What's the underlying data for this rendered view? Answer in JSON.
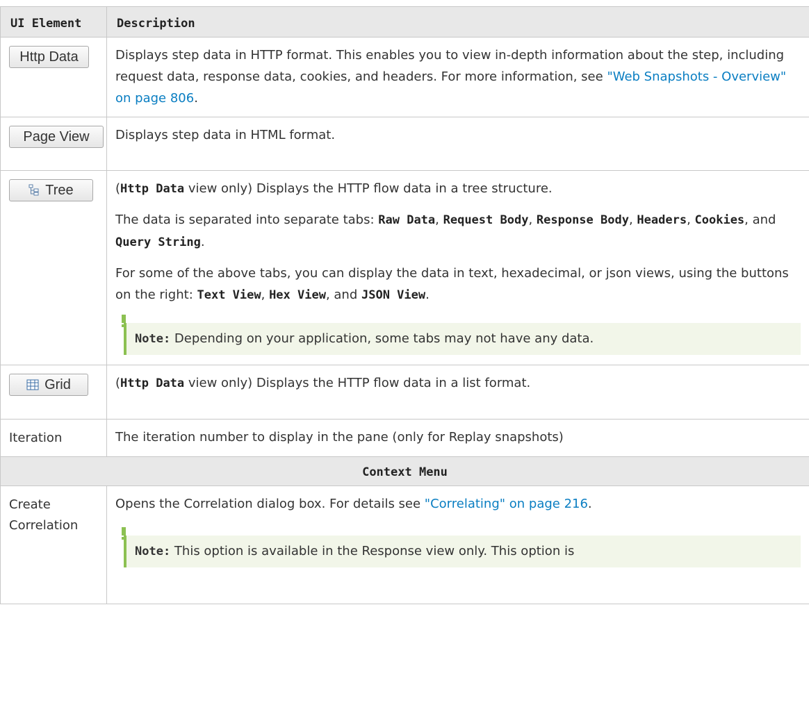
{
  "header": {
    "col1": "UI Element",
    "col2": "Description"
  },
  "rows": {
    "http_data": {
      "button_label": "Http Data",
      "desc_before_link": "Displays step data in HTTP format. This enables you to view in-depth information about the step, including request data, response data, cookies, and headers. For more information, see ",
      "link": "\"Web Snapshots - Overview\" on page 806",
      "desc_after_link": "."
    },
    "page_view": {
      "button_label": "Page View",
      "desc": "Displays step data in HTML format."
    },
    "tree": {
      "button_label": "Tree",
      "icon": "tree-icon",
      "p1_bold": "Http Data",
      "p1_rest": " view only) Displays the HTTP flow data in a tree structure.",
      "p2_pre": "The data is separated into separate tabs: ",
      "tabs": [
        "Raw Data",
        "Request Body",
        "Response Body",
        "Headers",
        "Cookies",
        "Query String"
      ],
      "p3_pre": "For some of the above tabs, you can display the data in text, hexadecimal, or json views, using the buttons on the right: ",
      "views": [
        "Text View",
        "Hex View",
        "JSON View"
      ],
      "note_label": "Note:",
      "note_text": " Depending on your application, some tabs may not have any data."
    },
    "grid": {
      "button_label": "Grid",
      "icon": "grid-icon",
      "bold": "Http Data",
      "rest": " view only) Displays the HTTP flow data in a list format."
    },
    "iteration": {
      "label": "Iteration",
      "desc": "The iteration number to display in the pane (only for Replay snapshots)"
    },
    "section": {
      "title": "Context Menu"
    },
    "create_correlation": {
      "label_line1": "Create",
      "label_line2": "Correlation",
      "desc_before_link": "Opens the Correlation dialog box. For details see ",
      "link": "\"Correlating\" on page 216",
      "desc_after_link": ".",
      "note_label": "Note:",
      "note_text": " This option is available in the Response view only. This option is"
    }
  },
  "punct": {
    "open_paren": "(",
    "comma": ", ",
    "comma_and": ", and ",
    "period": "."
  },
  "colors": {
    "link": "#0a7ec2",
    "note_bar": "#8cc152",
    "note_bg": "#f2f6e9",
    "header_bg": "#e8e8e8"
  }
}
